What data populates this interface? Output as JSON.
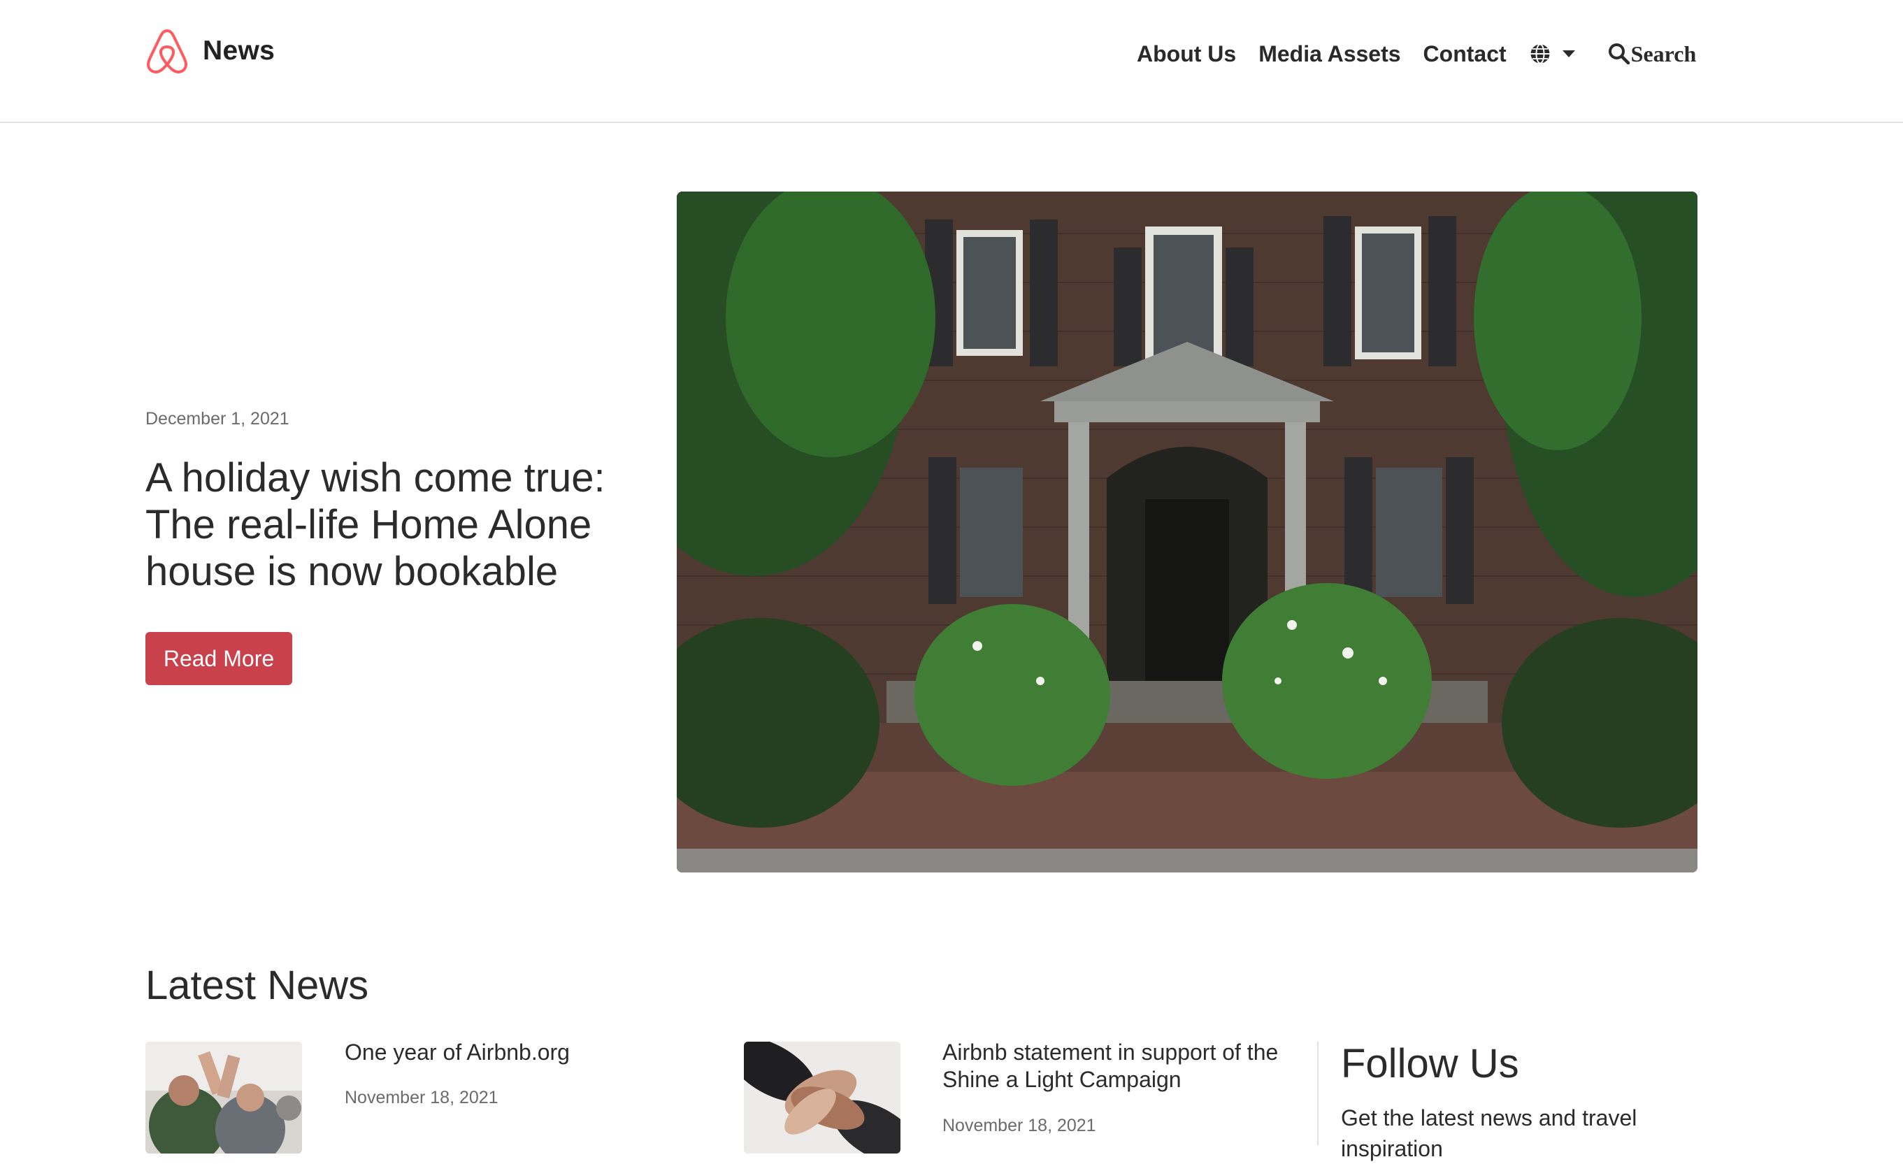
{
  "header": {
    "brand_name": "News",
    "logo_icon": "airbnb-belo-icon",
    "brand_color": "#ff5a5f",
    "nav_items": [
      {
        "label": "About Us"
      },
      {
        "label": "Media Assets"
      },
      {
        "label": "Contact"
      }
    ],
    "language_icon": "globe-icon",
    "search_icon": "search-icon",
    "search_label": "Search"
  },
  "hero": {
    "date": "December 1, 2021",
    "title": "A holiday wish come true: The real-life Home Alone house is now bookable",
    "button_label": "Read More",
    "button_color": "#c8414b",
    "image": "brick-colonial-house-photo"
  },
  "latest_news": {
    "heading": "Latest News",
    "items": [
      {
        "title": "One year of Airbnb.org",
        "date": "November 18, 2021",
        "image": "people-high-five-photo"
      },
      {
        "title": "Airbnb statement in support of the Shine a Light Campaign",
        "date": "November 18, 2021",
        "image": "stacked-hands-photo"
      }
    ]
  },
  "follow": {
    "heading": "Follow Us",
    "text": "Get the latest news and travel inspiration"
  }
}
